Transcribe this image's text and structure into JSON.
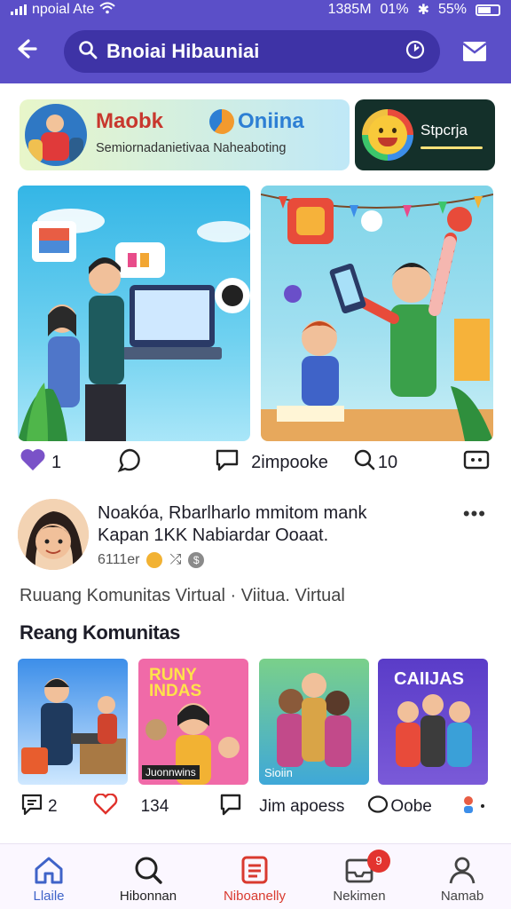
{
  "status": {
    "carrier": "npoial Ate",
    "time": "1385M",
    "percent_left": "01%",
    "battery": "55%"
  },
  "header": {
    "search_text": "Bnoiai Hibauniai"
  },
  "banners": [
    {
      "title": "Maobk",
      "title2": "Oniina",
      "subtitle": "Semiornadanietivaa Naheaboting"
    },
    {
      "title": "Stpcrja"
    }
  ],
  "reactions": {
    "likes": "1",
    "shares": "2impooke",
    "comments": "10"
  },
  "post": {
    "line1": "Noakóa, Rbarlharlo mmitom mank",
    "line2": "Kapan 1KK Nabiardar Ooaat.",
    "meta": "6111er"
  },
  "subtitle": "Ruuang Komunitas Virtual · Viitua. Virtual",
  "section_title": "Reang Komunitas",
  "thumbs": [
    {
      "label": ""
    },
    {
      "label": "RUNY INDAS",
      "tag": "Juonnwins"
    },
    {
      "label": "",
      "tag": "Sioiin"
    },
    {
      "label": "CAIIJAS"
    }
  ],
  "reactions2": {
    "comments": "2",
    "likes": "134",
    "shares": "Jim apoess",
    "extra": "Oobe"
  },
  "nav": {
    "items": [
      {
        "label": "Llaile",
        "color": "#3f63c8"
      },
      {
        "label": "Hibonnan",
        "color": "#222"
      },
      {
        "label": "Niboanelly",
        "color": "#d93a2f"
      },
      {
        "label": "Nekimen",
        "color": "#444",
        "badge": "9"
      },
      {
        "label": "Namab",
        "color": "#444"
      }
    ]
  }
}
